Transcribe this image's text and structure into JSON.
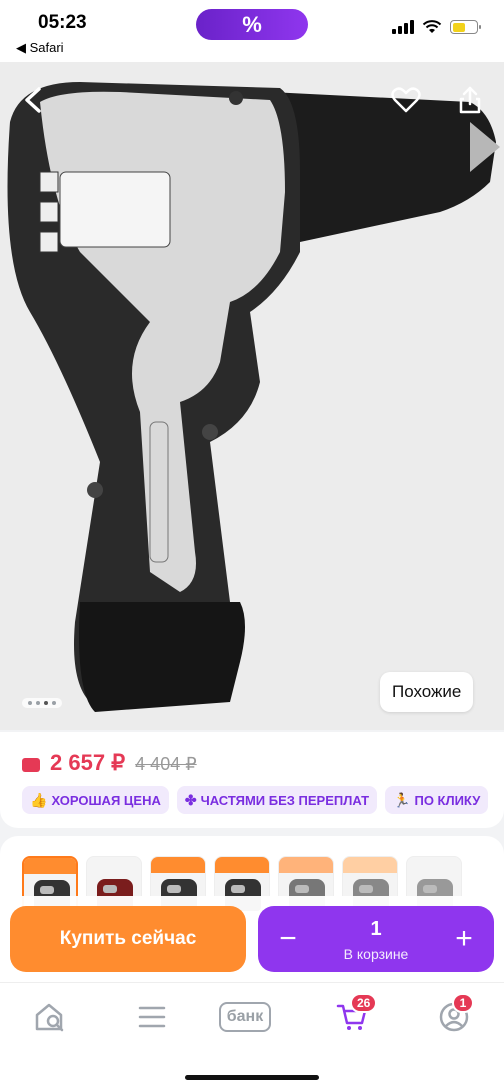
{
  "status_bar": {
    "time": "05:23",
    "back_app": "◀ Safari",
    "promo_symbol": "%"
  },
  "hero": {
    "similar_label": "Похожие",
    "image_dots": 4,
    "active_dot": 3
  },
  "price": {
    "current": "2 657 ₽",
    "old": "4 404 ₽",
    "accent_color": "#e53955"
  },
  "badges": [
    {
      "icon": "thumbs-up-icon",
      "label": "ХОРОШАЯ ЦЕНА"
    },
    {
      "icon": "installments-icon",
      "label": "ЧАСТЯМИ БЕЗ ПЕРЕПЛАТ"
    },
    {
      "icon": "runner-icon",
      "label": "ПО КЛИКУ"
    }
  ],
  "action": {
    "buy_label": "Купить сейчас",
    "cart_qty": "1",
    "cart_sub": "В корзине",
    "minus": "−",
    "plus": "+",
    "buy_color": "#ff8c2f",
    "cart_color": "#8f36ee"
  },
  "tabs": {
    "bank_label": "банк",
    "cart_badge": "26",
    "profile_badge": "1"
  }
}
